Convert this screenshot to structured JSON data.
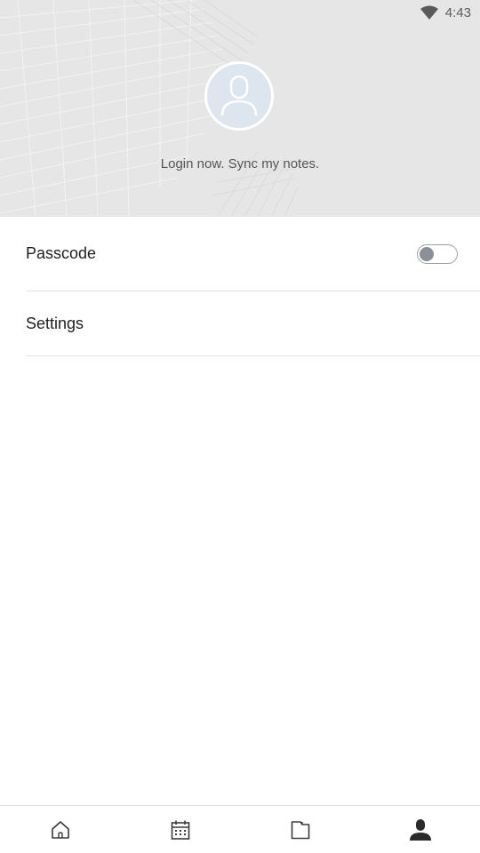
{
  "status_bar": {
    "time": "4:43",
    "wifi_icon": "wifi-icon"
  },
  "profile": {
    "avatar_icon": "user-avatar-icon",
    "login_text": "Login now. Sync my notes."
  },
  "menu": {
    "items": [
      {
        "label": "Passcode",
        "toggle_on": false
      },
      {
        "label": "Settings"
      }
    ]
  },
  "bottom_nav": {
    "items": [
      {
        "icon": "home-icon",
        "active": false
      },
      {
        "icon": "calendar-icon",
        "active": false
      },
      {
        "icon": "folder-icon",
        "active": false
      },
      {
        "icon": "profile-icon",
        "active": true
      }
    ]
  },
  "colors": {
    "header_bg": "#e6e6e6",
    "avatar_bg": "#dde6ee",
    "divider": "#e2e2e2",
    "active_icon": "#2b2b2b"
  }
}
